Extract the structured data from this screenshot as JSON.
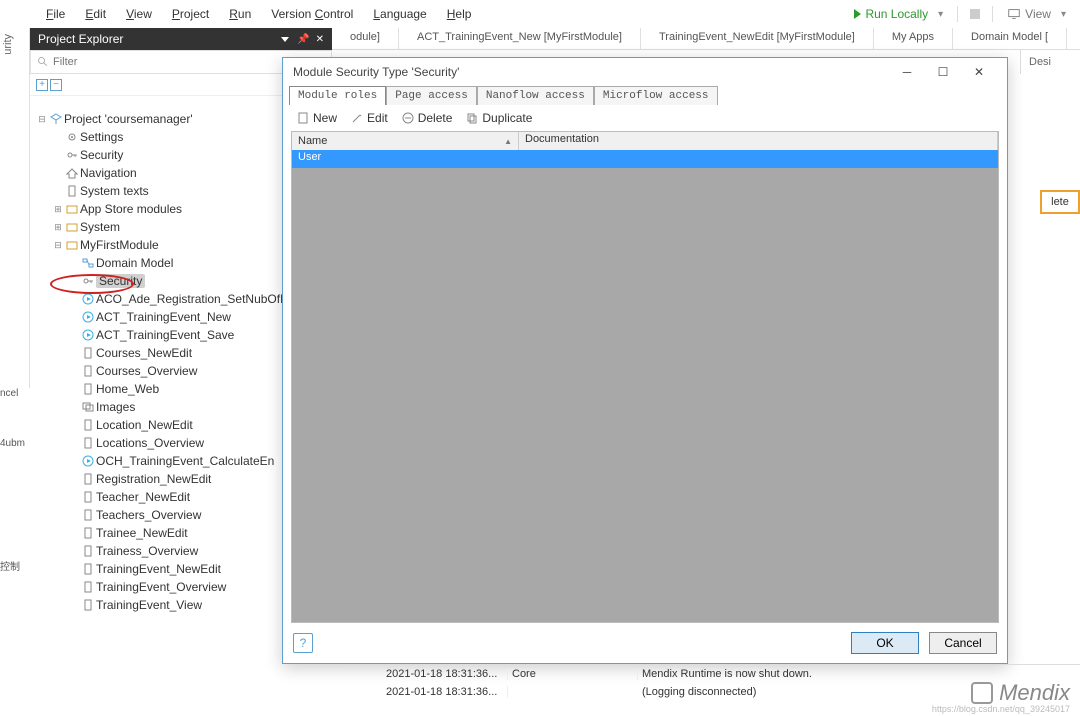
{
  "menubar": {
    "items": [
      "File",
      "Edit",
      "View",
      "Project",
      "Run",
      "Version Control",
      "Language",
      "Help"
    ],
    "run_label": "Run Locally",
    "view_label": "View"
  },
  "left_strip": {
    "label": "urity"
  },
  "panel": {
    "title": "Project Explorer",
    "filter_placeholder": "Filter"
  },
  "tabs": [
    "odule]",
    "ACT_TrainingEvent_New [MyFirstModule]",
    "TrainingEvent_NewEdit [MyFirstModule]",
    "My Apps",
    "Domain Model ["
  ],
  "right_sidetab": "Desi",
  "delete_frag": "lete",
  "left_frags": {
    "cancel": "ncel",
    "submit": "4ubm",
    "ctrl": "控制"
  },
  "tree": [
    {
      "depth": 0,
      "exp": "⊟",
      "icon": "cube",
      "label": "Project 'coursemanager'"
    },
    {
      "depth": 1,
      "exp": "",
      "icon": "gear",
      "label": "Settings"
    },
    {
      "depth": 1,
      "exp": "",
      "icon": "key",
      "label": "Security"
    },
    {
      "depth": 1,
      "exp": "",
      "icon": "home",
      "label": "Navigation"
    },
    {
      "depth": 1,
      "exp": "",
      "icon": "page",
      "label": "System texts"
    },
    {
      "depth": 1,
      "exp": "⊞",
      "icon": "folder",
      "label": "App Store modules"
    },
    {
      "depth": 1,
      "exp": "⊞",
      "icon": "folder",
      "label": "System"
    },
    {
      "depth": 1,
      "exp": "⊟",
      "icon": "folder",
      "label": "MyFirstModule"
    },
    {
      "depth": 2,
      "exp": "",
      "icon": "domain",
      "label": "Domain Model"
    },
    {
      "depth": 2,
      "exp": "",
      "icon": "key",
      "label": "Security",
      "hl": true
    },
    {
      "depth": 2,
      "exp": "",
      "icon": "play",
      "label": "ACO_Ade_Registration_SetNubOfRegi"
    },
    {
      "depth": 2,
      "exp": "",
      "icon": "play",
      "label": "ACT_TrainingEvent_New"
    },
    {
      "depth": 2,
      "exp": "",
      "icon": "play",
      "label": "ACT_TrainingEvent_Save"
    },
    {
      "depth": 2,
      "exp": "",
      "icon": "page",
      "label": "Courses_NewEdit"
    },
    {
      "depth": 2,
      "exp": "",
      "icon": "page",
      "label": "Courses_Overview"
    },
    {
      "depth": 2,
      "exp": "",
      "icon": "page",
      "label": "Home_Web"
    },
    {
      "depth": 2,
      "exp": "",
      "icon": "images",
      "label": "Images"
    },
    {
      "depth": 2,
      "exp": "",
      "icon": "page",
      "label": "Location_NewEdit"
    },
    {
      "depth": 2,
      "exp": "",
      "icon": "page",
      "label": "Locations_Overview"
    },
    {
      "depth": 2,
      "exp": "",
      "icon": "play",
      "label": "OCH_TrainingEvent_CalculateEn"
    },
    {
      "depth": 2,
      "exp": "",
      "icon": "page",
      "label": "Registration_NewEdit"
    },
    {
      "depth": 2,
      "exp": "",
      "icon": "page",
      "label": "Teacher_NewEdit"
    },
    {
      "depth": 2,
      "exp": "",
      "icon": "page",
      "label": "Teachers_Overview"
    },
    {
      "depth": 2,
      "exp": "",
      "icon": "page",
      "label": "Trainee_NewEdit"
    },
    {
      "depth": 2,
      "exp": "",
      "icon": "page",
      "label": "Trainess_Overview"
    },
    {
      "depth": 2,
      "exp": "",
      "icon": "page",
      "label": "TrainingEvent_NewEdit"
    },
    {
      "depth": 2,
      "exp": "",
      "icon": "page",
      "label": "TrainingEvent_Overview"
    },
    {
      "depth": 2,
      "exp": "",
      "icon": "page",
      "label": "TrainingEvent_View"
    }
  ],
  "dialog": {
    "title": "Module Security Type 'Security'",
    "tabs": [
      "Module roles",
      "Page access",
      "Nanoflow access",
      "Microflow access"
    ],
    "toolbar": {
      "new": "New",
      "edit": "Edit",
      "delete": "Delete",
      "duplicate": "Duplicate"
    },
    "columns": {
      "name": "Name",
      "doc": "Documentation"
    },
    "rows": [
      {
        "name": "User",
        "doc": ""
      }
    ],
    "ok": "OK",
    "cancel": "Cancel",
    "help": "?"
  },
  "console": [
    {
      "ts": "2021-01-18 18:31:36...",
      "cat": "Core",
      "msg": "Mendix Runtime is now shut down."
    },
    {
      "ts": "2021-01-18 18:31:36...",
      "cat": "",
      "msg": "(Logging disconnected)"
    }
  ],
  "watermark": {
    "text": "Mendix",
    "url": "https://blog.csdn.net/qq_39245017"
  }
}
